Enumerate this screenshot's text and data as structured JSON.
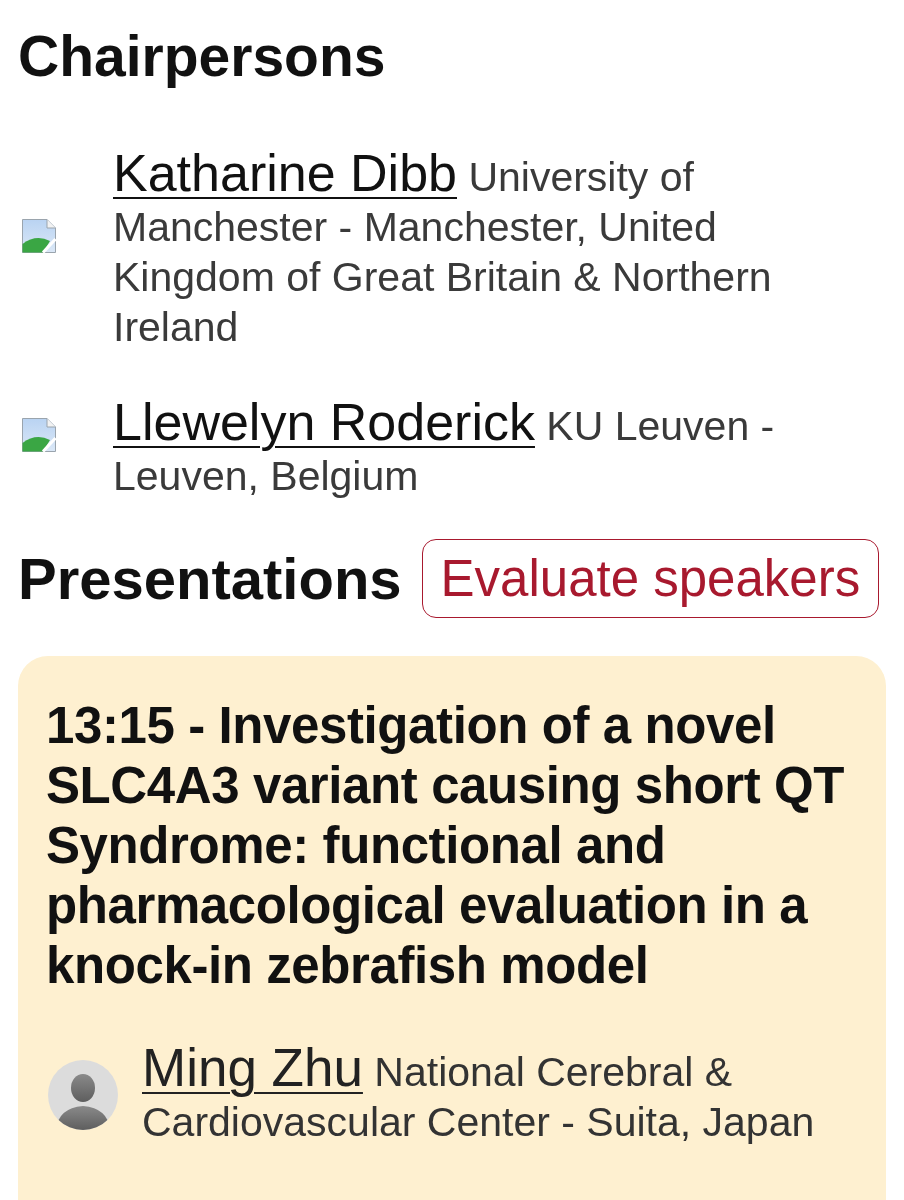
{
  "chairpersons": {
    "heading": "Chairpersons",
    "people": [
      {
        "name": "Katharine Dibb",
        "affiliation": "University of Manchester - Manchester, United Kingdom of Great Britain & Northern Ireland"
      },
      {
        "name": "Llewelyn Roderick",
        "affiliation": "KU Leuven - Leuven, Belgium"
      }
    ]
  },
  "presentations": {
    "heading": "Presentations",
    "evaluate_button": "Evaluate speakers",
    "items": [
      {
        "title": "13:15 - Investigation of a novel SLC4A3 variant causing short QT Syndrome: functional and pharmacological evaluation in a knock-in zebrafish model",
        "speakers": [
          {
            "name": "Ming Zhu",
            "affiliation": "National Cerebral & Cardiovascular Center - Suita, Japan"
          }
        ]
      }
    ]
  }
}
